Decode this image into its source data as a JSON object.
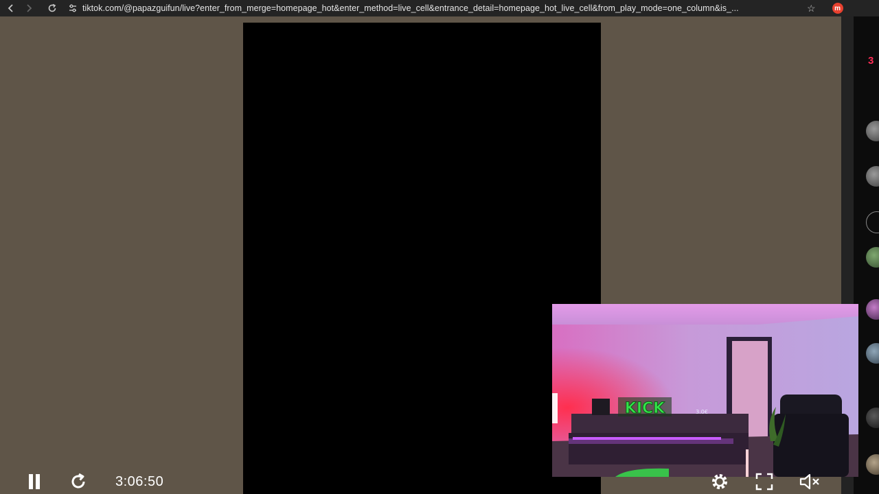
{
  "browser": {
    "url": "tiktok.com/@papazguifun/live?enter_from_merge=homepage_hot&enter_method=live_cell&entrance_detail=homepage_hot_live_cell&from_play_mode=one_column&is_...",
    "extension_letter": "m"
  },
  "side_panel": {
    "badge": "3"
  },
  "pip": {
    "sign_text": "KICK",
    "small_label": "3.0€"
  },
  "player": {
    "time": "3:06:50"
  },
  "icons": {
    "back": "back-arrow-icon",
    "forward": "forward-arrow-icon",
    "reload": "reload-icon",
    "site_info": "tune-icon",
    "bookmark": "star-icon",
    "pause": "pause-icon",
    "refresh": "refresh-icon",
    "settings": "gear-icon",
    "fullscreen": "fullscreen-icon",
    "volume": "volume-icon"
  },
  "colors": {
    "backdrop": "#5f5548",
    "accent": "#fe2c55",
    "neon_green": "#34e34a",
    "neon_purple": "#c85cff"
  }
}
